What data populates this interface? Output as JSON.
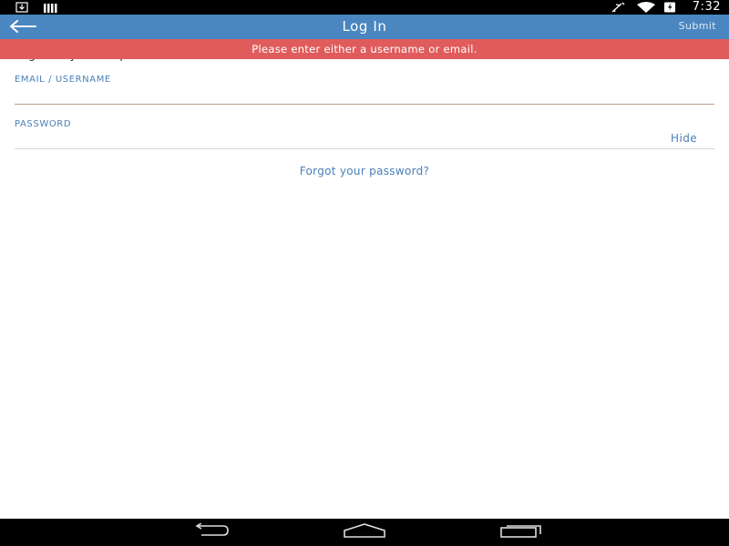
{
  "status_bar": {
    "time": "7:32",
    "icons": [
      "download-icon",
      "signal-bars-icon",
      "airplane-mode-icon",
      "wifi-icon",
      "battery-charging-icon"
    ]
  },
  "action_bar": {
    "title": "Log In",
    "submit_label": "Submit",
    "back_icon": "arrow-left-icon",
    "color": "#4a86c0"
  },
  "error": {
    "message": "Please enter either a username or email.",
    "color": "#e05c5c"
  },
  "form": {
    "intro": "Log in to your HelpHalloo account",
    "email_label": "EMAIL / USERNAME",
    "email_value": "",
    "password_label": "PASSWORD",
    "password_value": "",
    "hide_label": "Hide",
    "forgot_label": "Forgot your password?",
    "accent_color": "#4a7fb8",
    "active_underline_color": "#c09a8a"
  },
  "nav_bar": {
    "icons": [
      "back-nav-icon",
      "home-nav-icon",
      "recents-nav-icon"
    ]
  }
}
